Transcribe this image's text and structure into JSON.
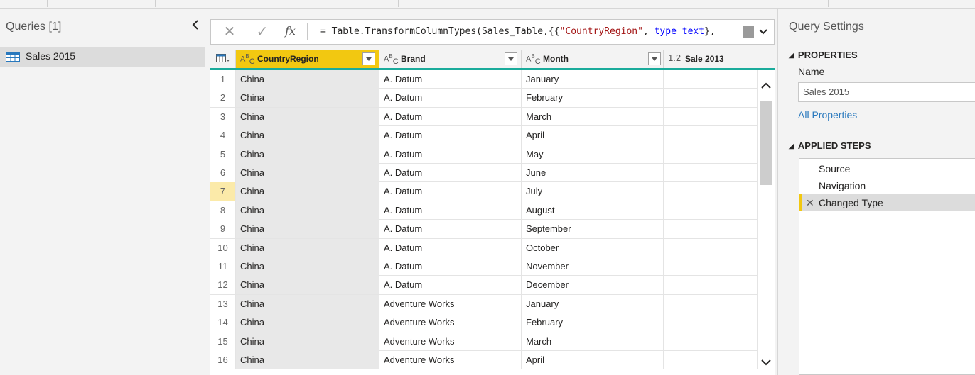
{
  "queries_pane": {
    "title": "Queries [1]",
    "items": [
      {
        "label": "Sales 2015"
      }
    ]
  },
  "formula_bar": {
    "prefix": "= Table.TransformColumnTypes(Sales_Table,{{",
    "string1": "\"CountryRegion\"",
    "mid": ", ",
    "keyword": "type text",
    "suffix": "},"
  },
  "columns": [
    {
      "type_icon": "ABC",
      "name": "CountryRegion"
    },
    {
      "type_icon": "ABC",
      "name": "Brand"
    },
    {
      "type_icon": "ABC",
      "name": "Month"
    },
    {
      "type_icon": "1.2",
      "name": "Sale 2013"
    }
  ],
  "rows": [
    [
      "1",
      "China",
      "A. Datum",
      "January",
      ""
    ],
    [
      "2",
      "China",
      "A. Datum",
      "February",
      ""
    ],
    [
      "3",
      "China",
      "A. Datum",
      "March",
      ""
    ],
    [
      "4",
      "China",
      "A. Datum",
      "April",
      ""
    ],
    [
      "5",
      "China",
      "A. Datum",
      "May",
      ""
    ],
    [
      "6",
      "China",
      "A. Datum",
      "June",
      ""
    ],
    [
      "7",
      "China",
      "A. Datum",
      "July",
      ""
    ],
    [
      "8",
      "China",
      "A. Datum",
      "August",
      ""
    ],
    [
      "9",
      "China",
      "A. Datum",
      "September",
      ""
    ],
    [
      "10",
      "China",
      "A. Datum",
      "October",
      ""
    ],
    [
      "11",
      "China",
      "A. Datum",
      "November",
      ""
    ],
    [
      "12",
      "China",
      "A. Datum",
      "December",
      ""
    ],
    [
      "13",
      "China",
      "Adventure Works",
      "January",
      ""
    ],
    [
      "14",
      "China",
      "Adventure Works",
      "February",
      ""
    ],
    [
      "15",
      "China",
      "Adventure Works",
      "March",
      ""
    ],
    [
      "16",
      "China",
      "Adventure Works",
      "April",
      ""
    ]
  ],
  "selected_row": "7",
  "settings": {
    "title": "Query Settings",
    "properties_heading": "PROPERTIES",
    "name_label": "Name",
    "name_value": "Sales 2015",
    "all_properties": "All Properties",
    "steps_heading": "APPLIED STEPS",
    "steps": [
      "Source",
      "Navigation",
      "Changed Type"
    ]
  },
  "colors": {
    "accent": "#f2c811",
    "teal": "#1aab9b",
    "link": "#2878bd"
  }
}
